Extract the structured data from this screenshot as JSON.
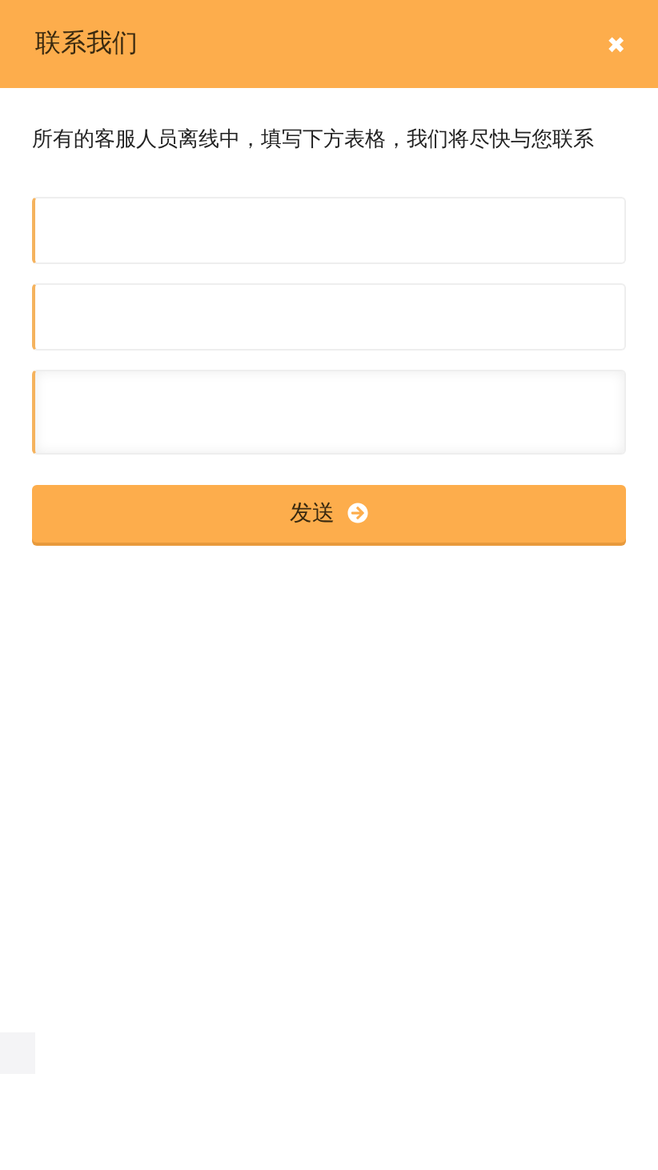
{
  "header": {
    "title": "联系我们",
    "close": "✖"
  },
  "intro": "所有的客服人员离线中，填写下方表格，我们将尽快与您联系",
  "fields": [
    {
      "kind": "input"
    },
    {
      "kind": "input"
    },
    {
      "kind": "textarea"
    }
  ],
  "submit": {
    "label": "发送"
  }
}
